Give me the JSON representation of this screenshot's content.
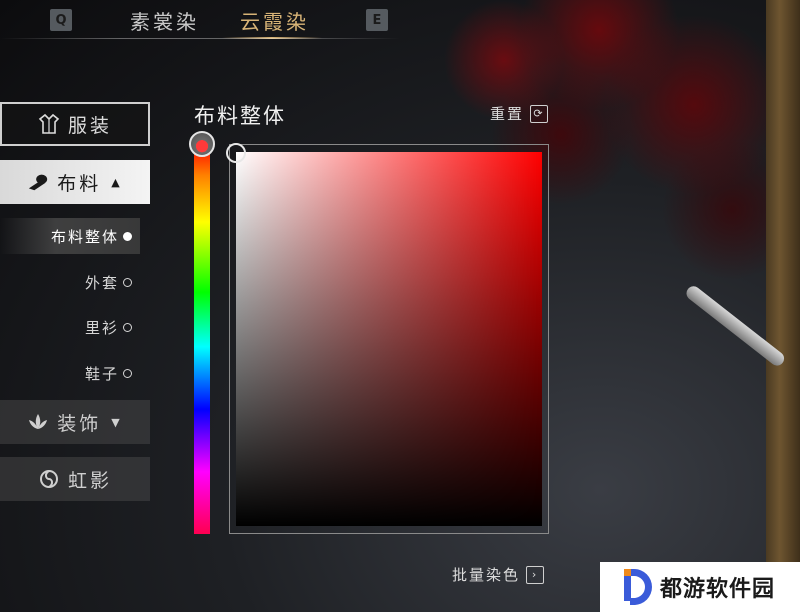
{
  "top_tabs": {
    "left_key": "Q",
    "right_key": "E",
    "tabs": [
      {
        "label": "素裳染",
        "active": false
      },
      {
        "label": "云霞染",
        "active": true
      }
    ]
  },
  "sidebar": {
    "categories": [
      {
        "label": "服装",
        "icon": "robe-icon",
        "state": "outline"
      },
      {
        "label": "布料",
        "icon": "fabric-roll-icon",
        "state": "selected",
        "expanded": true
      },
      {
        "label": "装饰",
        "icon": "lotus-icon",
        "state": "collapsed"
      },
      {
        "label": "虹影",
        "icon": "swirl-icon",
        "state": "normal"
      }
    ],
    "sub_items": [
      {
        "label": "布料整体",
        "selected": true
      },
      {
        "label": "外套",
        "selected": false
      },
      {
        "label": "里衫",
        "selected": false
      },
      {
        "label": "鞋子",
        "selected": false
      }
    ]
  },
  "panel": {
    "title": "布料整体",
    "reset_label": "重置",
    "batch_dye_label": "批量染色",
    "selected_hue_color": "#ff0000"
  },
  "watermark": {
    "text": "都游软件园"
  },
  "colors": {
    "accent_gold": "#d8b477",
    "text_light": "#e8e8e8"
  }
}
